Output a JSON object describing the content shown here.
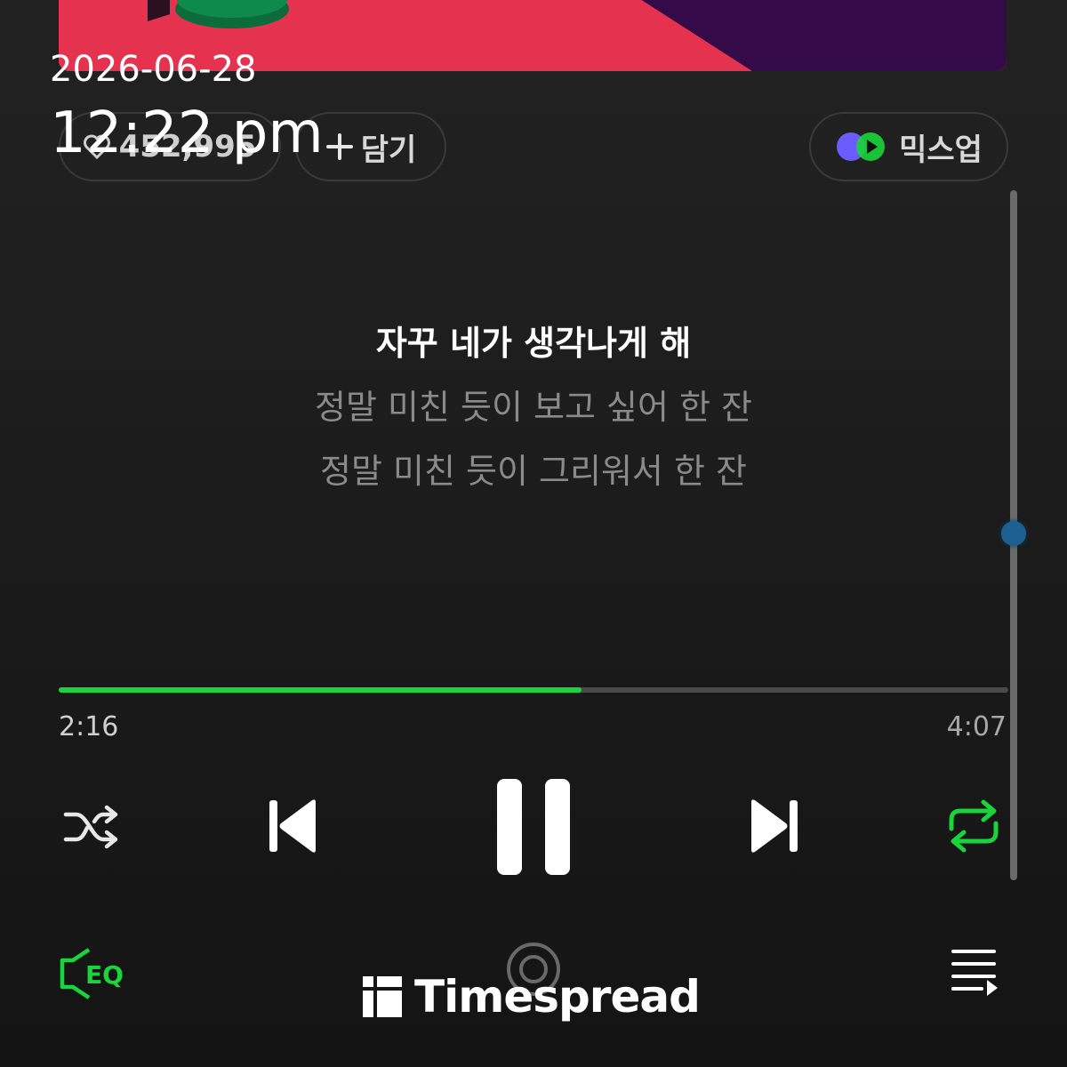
{
  "album_art": {
    "colors": [
      "#e5334f",
      "#350a48",
      "#0f8a4d"
    ]
  },
  "overlay": {
    "date": "2026-06-28",
    "time": "12:22 pm"
  },
  "actions": {
    "like_count": "452,995",
    "add_label": "담기",
    "mixup_label": "믹스업"
  },
  "lyrics": {
    "current": "자꾸 네가 생각나게 해",
    "next1": "정말 미친 듯이 보고 싶어 한 잔",
    "next2": "정말 미친 듯이 그리워서 한 잔"
  },
  "playback": {
    "elapsed": "2:16",
    "duration": "4:07",
    "progress_fraction": 0.551,
    "accent": "#19d43a",
    "repeat_active": true
  },
  "bottom_bar": {
    "eq_label": "EQ"
  },
  "watermark": {
    "text": "Timespread"
  }
}
